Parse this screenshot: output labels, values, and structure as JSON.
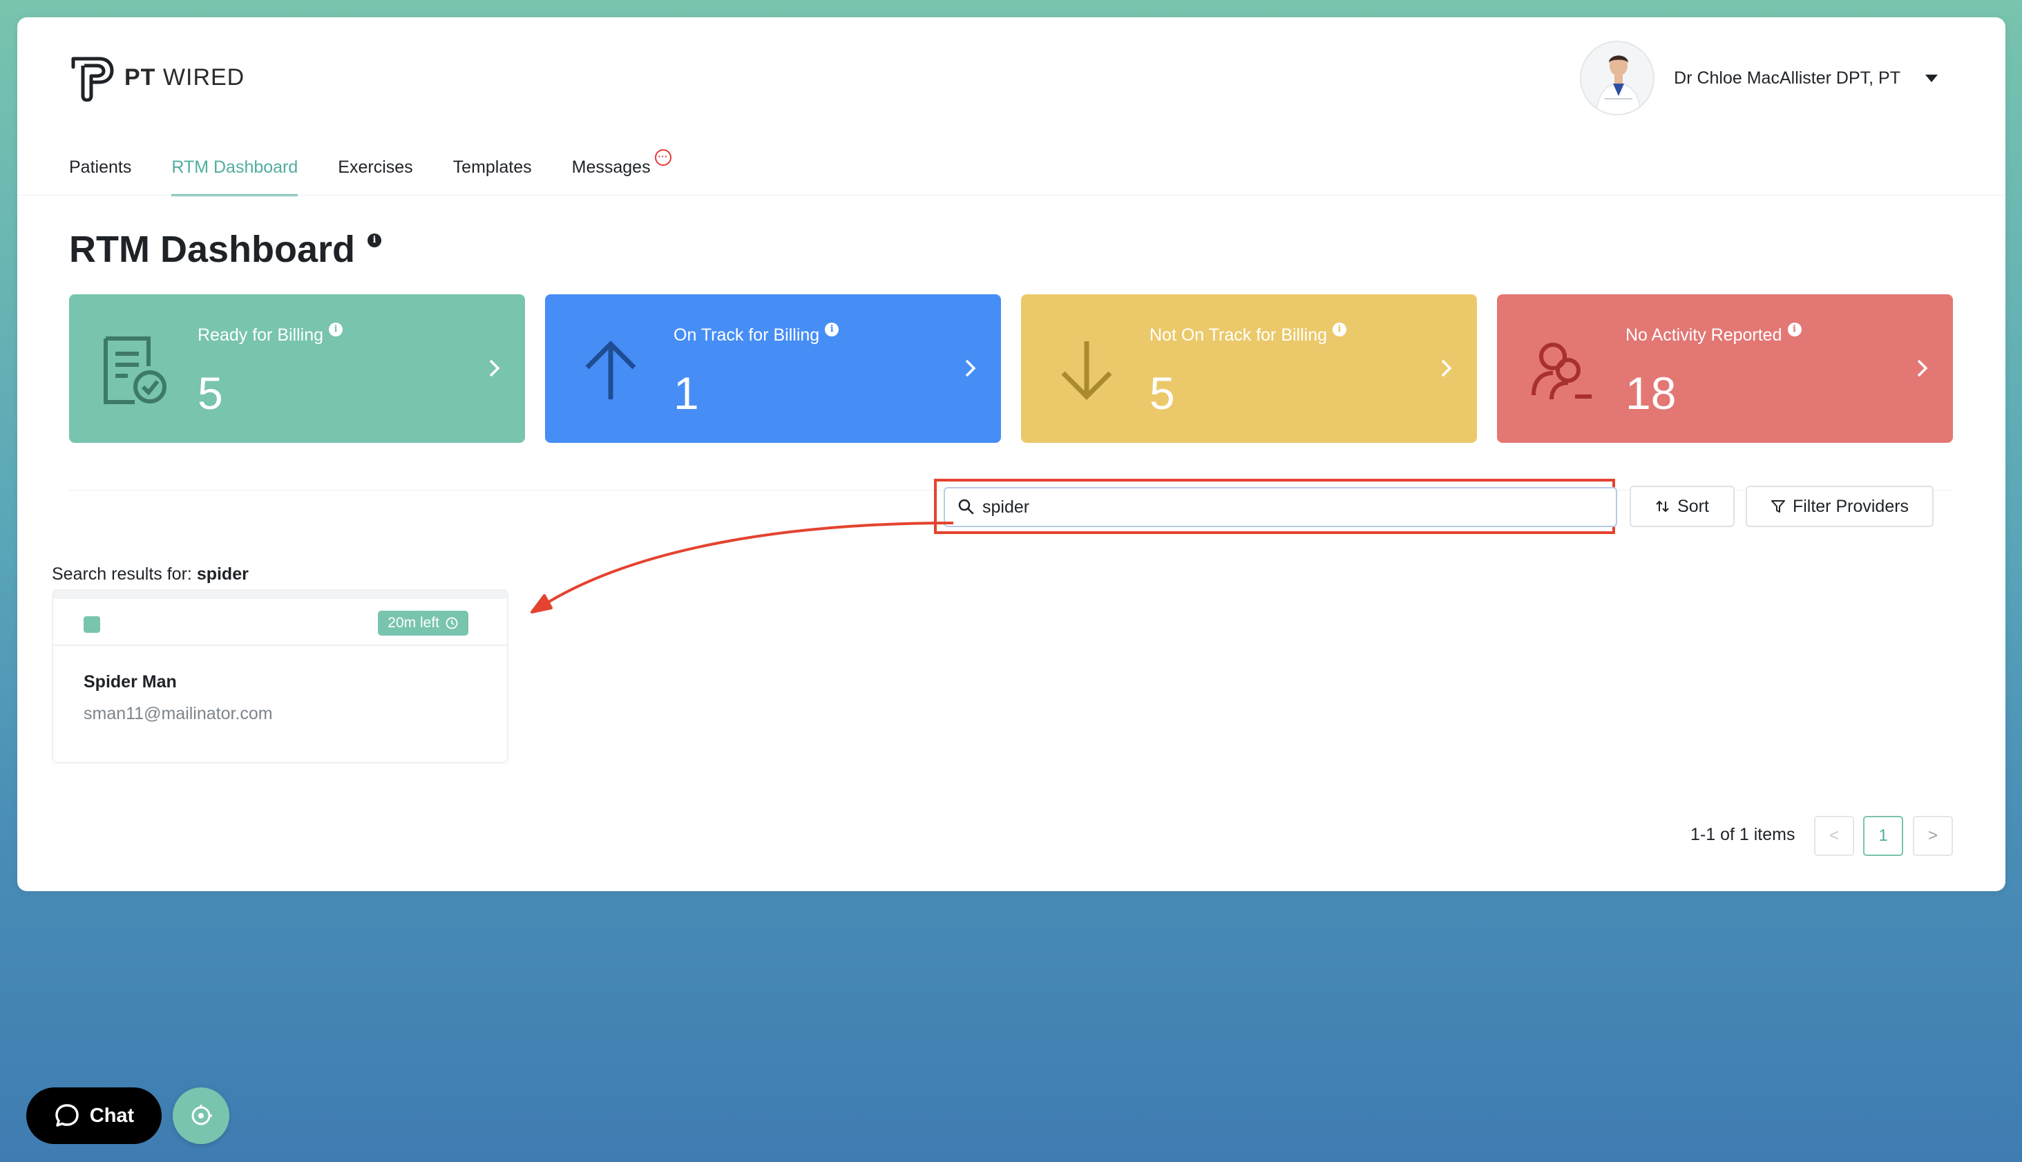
{
  "brand": {
    "name_bold": "PT",
    "name_light": "WIRED"
  },
  "user": {
    "name": "Dr Chloe MacAllister DPT, PT",
    "avatar": "doctor-avatar"
  },
  "nav": {
    "items": [
      {
        "label": "Patients"
      },
      {
        "label": "RTM Dashboard",
        "active": true
      },
      {
        "label": "Exercises"
      },
      {
        "label": "Templates"
      },
      {
        "label": "Messages",
        "badge": "···"
      }
    ]
  },
  "page": {
    "title": "RTM Dashboard"
  },
  "cards": [
    {
      "label": "Ready for Billing",
      "value": "5",
      "icon": "billing-doc-check-icon",
      "color": "#78c4ae"
    },
    {
      "label": "On Track for Billing",
      "value": "1",
      "icon": "arrow-up-icon",
      "color": "#468ef6"
    },
    {
      "label": "Not On Track for Billing",
      "value": "5",
      "icon": "arrow-down-icon",
      "color": "#ebc96b"
    },
    {
      "label": "No Activity Reported",
      "value": "18",
      "icon": "user-minus-icon",
      "color": "#e37774"
    }
  ],
  "search": {
    "value": "spider",
    "placeholder": ""
  },
  "toolbar": {
    "sort_label": "Sort",
    "filter_label": "Filter Providers"
  },
  "results": {
    "prefix": "Search results for:",
    "query": "spider",
    "items": [
      {
        "time_left": "20m left",
        "name": "Spider Man",
        "email": "sman11@mailinator.com"
      }
    ]
  },
  "pagination": {
    "summary": "1-1 of 1 items",
    "current_page": "1",
    "prev": "<",
    "next": ">"
  },
  "chat": {
    "label": "Chat"
  },
  "colors": {
    "accent": "#4fae9f",
    "annotation": "#e4432f"
  }
}
